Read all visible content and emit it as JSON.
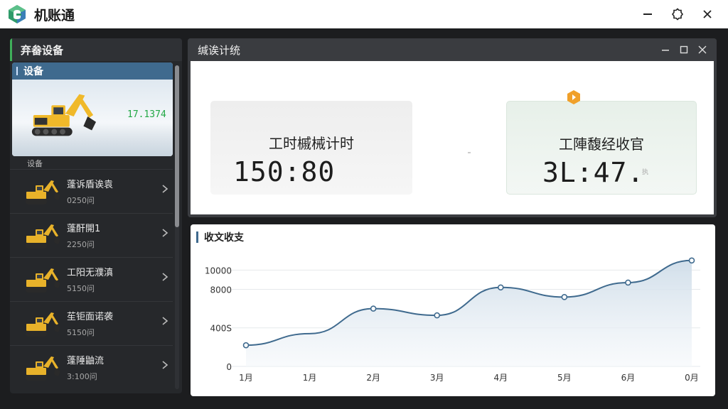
{
  "app": {
    "title": "机账通"
  },
  "sidebar": {
    "header": "弃畚设备",
    "featured": {
      "label": "设备",
      "value": "17.1374"
    },
    "section_label": "设备",
    "items": [
      {
        "name": "蓬诉盾诶袁",
        "sub": "0250问"
      },
      {
        "name": "蓬酐開1",
        "sub": "2250问"
      },
      {
        "name": "工阳无濮滇",
        "sub": "5150问"
      },
      {
        "name": "苼钜面诺袭",
        "sub": "5150问"
      },
      {
        "name": "蓬陲鼬流",
        "sub": "3:100问"
      }
    ]
  },
  "stats_window": {
    "title": "缄诶计统",
    "cards": [
      {
        "label": "工时槭械计时",
        "value": "150:80"
      },
      {
        "label": "工陣馥经收官",
        "value": "3L:47.",
        "hint": "执"
      }
    ]
  },
  "chart_panel": {
    "title": "收文收支"
  },
  "chart_data": {
    "type": "area",
    "title": "收文收支",
    "categories": [
      "1月",
      "1月",
      "2月",
      "3月",
      "4月",
      "5月",
      "6月",
      "0月"
    ],
    "y_tick_labels": [
      "0",
      "400S",
      "8000",
      "10000"
    ],
    "y_tick_values": [
      0,
      4000,
      8000,
      10000
    ],
    "ylim": [
      0,
      11500
    ],
    "values": [
      2200,
      3400,
      6000,
      5300,
      8200,
      7200,
      8700,
      11000
    ],
    "grid": true,
    "line_color": "#3f6a8e",
    "fill_color": "#cfdde9"
  }
}
